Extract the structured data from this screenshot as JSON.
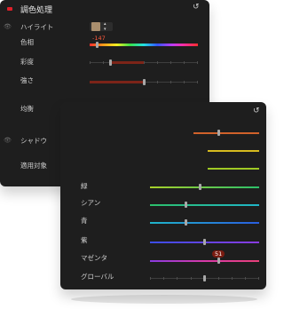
{
  "panel_top": {
    "title": "調色処理",
    "accent_color": "#e0202a",
    "highlight": {
      "label": "ハイライト",
      "swatch_color": "#a98e6d",
      "rows": [
        {
          "label": "色相",
          "value_text": "-147"
        },
        {
          "label": "彩度"
        },
        {
          "label": "強さ"
        }
      ]
    },
    "balance_label": "均衡",
    "shadow": {
      "label": "シャドウ",
      "swatch_color": "none"
    },
    "apply_target_label": "適用対象"
  },
  "panel_bottom": {
    "channels": [
      {
        "label": "緑"
      },
      {
        "label": "シアン"
      },
      {
        "label": "青"
      },
      {
        "label": "紫"
      },
      {
        "label": "マゼンタ",
        "value_text": "51"
      },
      {
        "label": "グローバル"
      }
    ]
  }
}
